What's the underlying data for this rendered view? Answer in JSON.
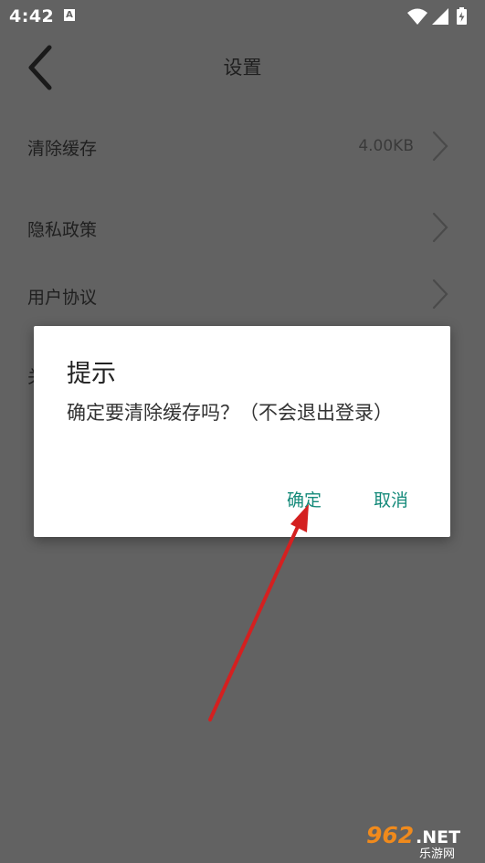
{
  "status_bar": {
    "time": "4:42",
    "notification_badge": "A",
    "icons": [
      "wifi-icon",
      "signal-icon",
      "battery-icon"
    ]
  },
  "header": {
    "title": "设置",
    "back_icon": "chevron-left-icon"
  },
  "settings_list": [
    {
      "label": "清除缓存",
      "value": "4.00KB"
    },
    {
      "label": "隐私政策"
    },
    {
      "label": "用户协议"
    },
    {
      "label_partial": "关"
    }
  ],
  "dialog": {
    "title": "提示",
    "message": "确定要清除缓存吗？（不会退出登录）",
    "confirm_label": "确定",
    "cancel_label": "取消"
  },
  "annotation": {
    "type": "red-arrow",
    "points_to": "确定"
  },
  "watermark": {
    "text": "962.NET",
    "subtext": "乐游网"
  },
  "colors": {
    "overlay_background": "#626262",
    "dialog_button": "#158a7a",
    "arrow": "#d42020"
  }
}
